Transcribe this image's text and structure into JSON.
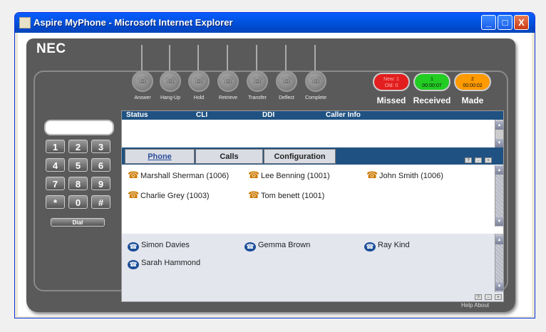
{
  "window": {
    "title": "Aspire MyPhone - Microsoft Internet Explorer",
    "minimize_label": "_",
    "maximize_label": "□",
    "close_label": "X"
  },
  "brand": "NEC",
  "function_buttons": [
    {
      "label": "Answer",
      "icon": "answer-icon"
    },
    {
      "label": "Hang-Up",
      "icon": "hangup-icon"
    },
    {
      "label": "Hold",
      "icon": "hold-icon"
    },
    {
      "label": "Retrieve",
      "icon": "retrieve-icon"
    },
    {
      "label": "Transfer",
      "icon": "transfer-icon"
    },
    {
      "label": "Deflect",
      "icon": "deflect-icon"
    },
    {
      "label": "Complete",
      "icon": "complete-icon"
    }
  ],
  "status_indicators": [
    {
      "label": "Missed",
      "line1": "New: 1",
      "line2": "Old: 0",
      "color": "#e21e1e"
    },
    {
      "label": "Received",
      "line1": "1",
      "line2": "00:00:07",
      "color": "#22cc22"
    },
    {
      "label": "Made",
      "line1": "2",
      "line2": "00:00:02",
      "color": "#ff9a00"
    }
  ],
  "keypad": {
    "keys": [
      "1",
      "2",
      "3",
      "4",
      "5",
      "6",
      "7",
      "8",
      "9",
      "*",
      "0",
      "#"
    ],
    "dial_label": "Dial"
  },
  "call_panel": {
    "columns": [
      "Status",
      "CLI",
      "DDI",
      "Caller Info"
    ]
  },
  "tabs": [
    "Phone",
    "Calls",
    "Configuration"
  ],
  "panel_controls": [
    "?",
    "-",
    "+"
  ],
  "extensions": [
    "Marshall Sherman (1006)",
    "Lee Benning (1001)",
    "John Smith (1006)",
    "Charlie Grey (1003)",
    "Tom benett (1001)"
  ],
  "contacts": [
    "Simon Davies",
    "Gemma Brown",
    "Ray Kind",
    "Sarah Hammond"
  ],
  "footer": {
    "help": "Help",
    "about": "About"
  },
  "colors": {
    "header_bar": "#1f5282",
    "titlebar": "#0054e3",
    "phone_body": "#5a5a5a"
  }
}
